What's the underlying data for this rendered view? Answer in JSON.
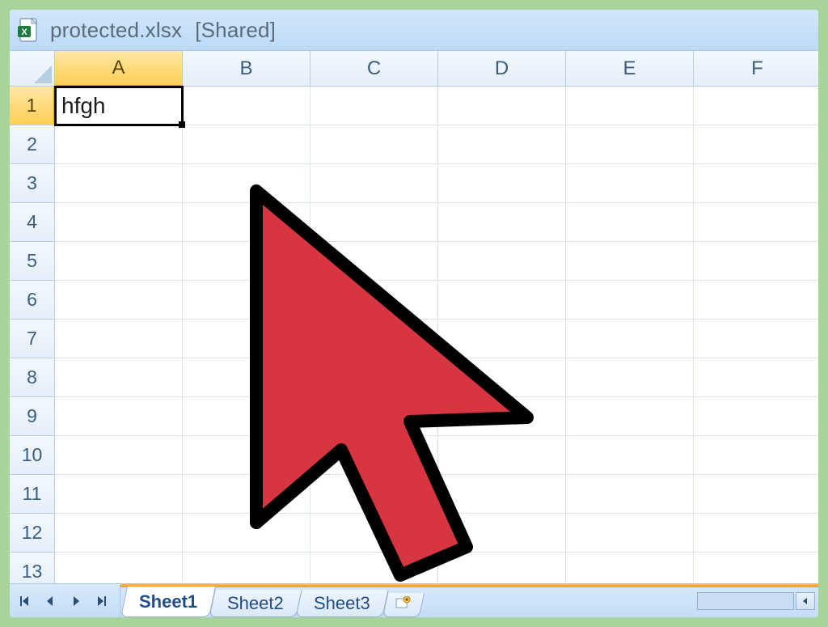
{
  "title": {
    "filename": "protected.xlsx",
    "suffix": "[Shared]"
  },
  "columns": [
    "A",
    "B",
    "C",
    "D",
    "E",
    "F"
  ],
  "rows": [
    "1",
    "2",
    "3",
    "4",
    "5",
    "6",
    "7",
    "8",
    "9",
    "10",
    "11",
    "12",
    "13"
  ],
  "active_column_index": 0,
  "active_row_index": 0,
  "cells": {
    "A1": "hfgh"
  },
  "selected_cell": "A1",
  "sheets": {
    "items": [
      "Sheet1",
      "Sheet2",
      "Sheet3"
    ],
    "active_index": 0
  },
  "colors": {
    "frame": "#a7d49b",
    "cursor_fill": "#d73641",
    "cursor_stroke": "#000000"
  }
}
